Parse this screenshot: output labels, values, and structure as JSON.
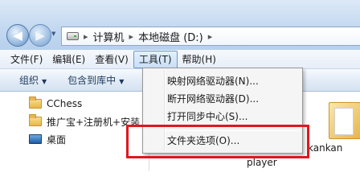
{
  "address_bar": {
    "breadcrumbs": [
      "计算机",
      "本地磁盘 (D:)"
    ],
    "separator": "▸"
  },
  "menubar": {
    "items": [
      "文件(F)",
      "编辑(E)",
      "查看(V)",
      "工具(T)",
      "帮助(H)"
    ],
    "active_item": "工具(T)"
  },
  "toolbar": {
    "organize": "组织",
    "include_in_library": "包含到库中"
  },
  "nav_pane": {
    "items": [
      {
        "label": "CChess",
        "icon": "folder-icon"
      },
      {
        "label": "推广宝+注册机+安装",
        "icon": "folder-icon"
      },
      {
        "label": "桌面",
        "icon": "desktop-icon"
      }
    ]
  },
  "content": {
    "labels": [
      "kankan",
      "player"
    ]
  },
  "tools_menu": {
    "items": [
      "映射网络驱动器(N)...",
      "断开网络驱动器(D)...",
      "打开同步中心(S)...",
      "文件夹选项(O)..."
    ],
    "highlighted_item": "文件夹选项(O)..."
  },
  "colors": {
    "highlight_border": "#e0171e",
    "menu_background": "#f5f5f5",
    "toolbar_gradient_top": "#f7fafe"
  }
}
